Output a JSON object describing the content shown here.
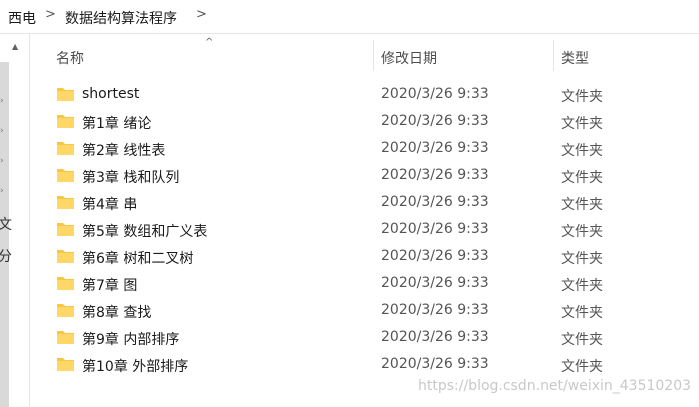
{
  "breadcrumb": {
    "items": [
      "西电",
      "数据结构算法程序"
    ],
    "separator": ">"
  },
  "nav": {
    "snippets": [
      "文",
      "分"
    ]
  },
  "columns": {
    "name": "名称",
    "date": "修改日期",
    "type": "类型"
  },
  "folder_color": "#f6c744",
  "rows": [
    {
      "name": "shortest",
      "date": "2020/3/26 9:33",
      "type": "文件夹"
    },
    {
      "name": "第1章 绪论",
      "date": "2020/3/26 9:33",
      "type": "文件夹"
    },
    {
      "name": "第2章 线性表",
      "date": "2020/3/26 9:33",
      "type": "文件夹"
    },
    {
      "name": "第3章 栈和队列",
      "date": "2020/3/26 9:33",
      "type": "文件夹"
    },
    {
      "name": "第4章 串",
      "date": "2020/3/26 9:33",
      "type": "文件夹"
    },
    {
      "name": "第5章 数组和广义表",
      "date": "2020/3/26 9:33",
      "type": "文件夹"
    },
    {
      "name": "第6章 树和二叉树",
      "date": "2020/3/26 9:33",
      "type": "文件夹"
    },
    {
      "name": "第7章 图",
      "date": "2020/3/26 9:33",
      "type": "文件夹"
    },
    {
      "name": "第8章 查找",
      "date": "2020/3/26 9:33",
      "type": "文件夹"
    },
    {
      "name": "第9章 内部排序",
      "date": "2020/3/26 9:33",
      "type": "文件夹"
    },
    {
      "name": "第10章 外部排序",
      "date": "2020/3/26 9:33",
      "type": "文件夹"
    }
  ],
  "watermark": "https://blog.csdn.net/weixin_43510203"
}
